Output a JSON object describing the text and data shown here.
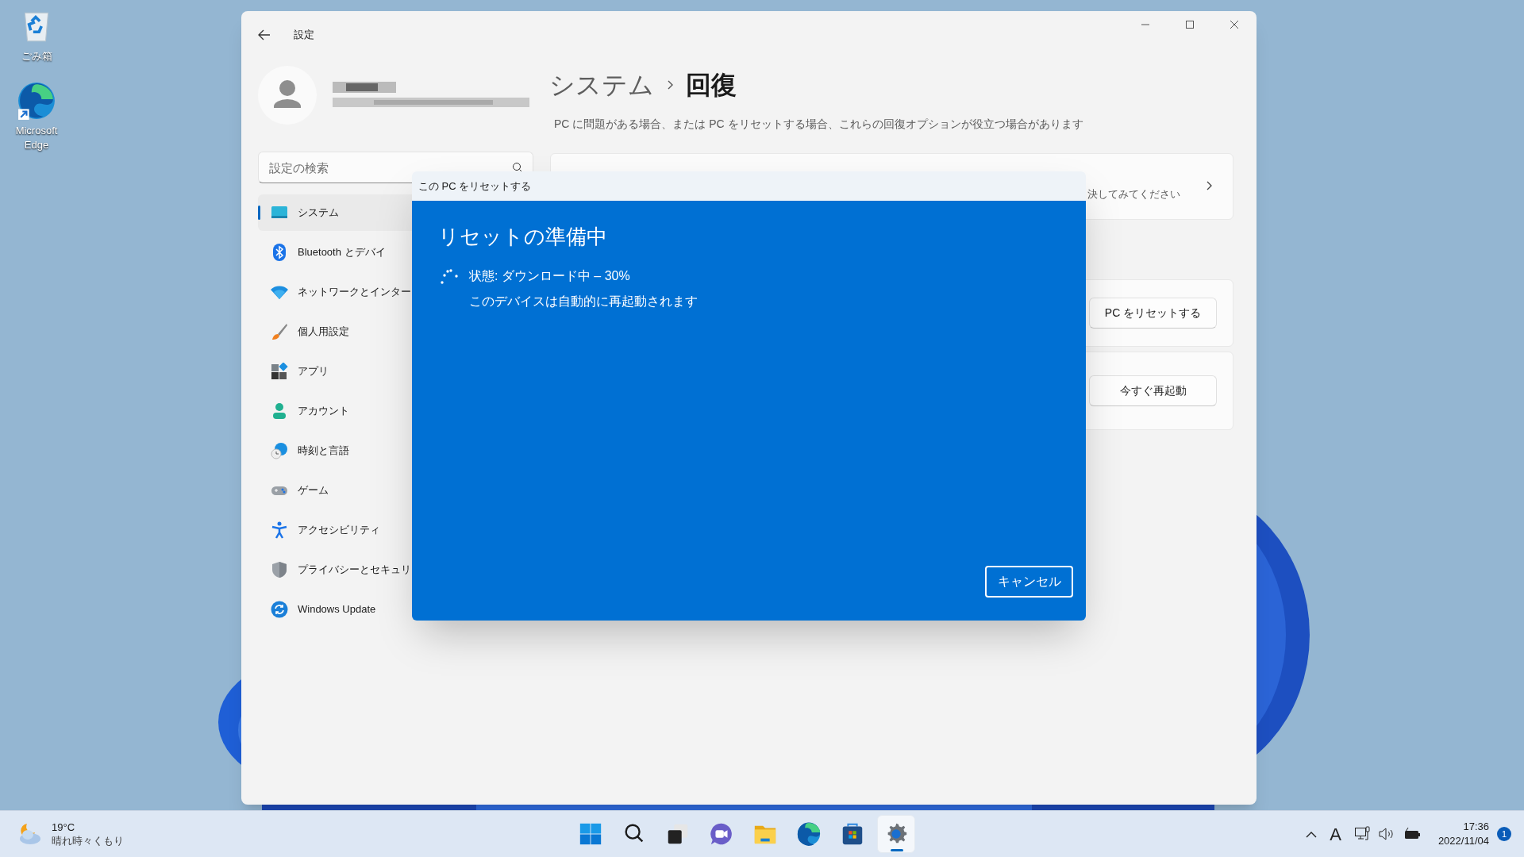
{
  "desktop": {
    "icons": [
      {
        "kind": "recycle-bin",
        "label": "ごみ箱"
      },
      {
        "kind": "edge-shortcut",
        "label": "Microsoft Edge"
      }
    ]
  },
  "settings_window": {
    "title": "設定",
    "search": {
      "placeholder": "設定の検索"
    },
    "sidebar": {
      "items": [
        {
          "kind": "system",
          "label": "システム",
          "selected": true
        },
        {
          "kind": "bluetooth",
          "label": "Bluetooth とデバイ",
          "selected": false
        },
        {
          "kind": "network",
          "label": "ネットワークとインター",
          "selected": false
        },
        {
          "kind": "personalization",
          "label": "個人用設定",
          "selected": false
        },
        {
          "kind": "apps",
          "label": "アプリ",
          "selected": false
        },
        {
          "kind": "accounts",
          "label": "アカウント",
          "selected": false
        },
        {
          "kind": "time",
          "label": "時刻と言語",
          "selected": false
        },
        {
          "kind": "gaming",
          "label": "ゲーム",
          "selected": false
        },
        {
          "kind": "accessibility",
          "label": "アクセシビリティ",
          "selected": false
        },
        {
          "kind": "privacy",
          "label": "プライバシーとセキュリ",
          "selected": false
        },
        {
          "kind": "update",
          "label": "Windows Update",
          "selected": false
        }
      ]
    },
    "breadcrumb": [
      "システム",
      "回復"
    ],
    "description": "PC に問題がある場合、または PC をリセットする場合、これらの回復オプションが役立つ場合があります",
    "cards": [
      {
        "kind": "link",
        "text": "決してみてください"
      },
      {
        "kind": "button",
        "button": "PC をリセットする"
      },
      {
        "kind": "button",
        "button": "今すぐ再起動"
      }
    ]
  },
  "dialog": {
    "title": "この PC をリセットする",
    "heading": "リセットの準備中",
    "status": "状態: ダウンロード中 – 30%",
    "note": "このデバイスは自動的に再起動されます",
    "cancel_button": "キャンセル"
  },
  "taskbar": {
    "weather": {
      "temperature": "19°C",
      "condition": "晴れ時々くもり"
    },
    "apps": [
      {
        "kind": "start",
        "active": false
      },
      {
        "kind": "search",
        "active": false
      },
      {
        "kind": "task-view",
        "active": false
      },
      {
        "kind": "chat",
        "active": false
      },
      {
        "kind": "explorer",
        "active": false
      },
      {
        "kind": "edge",
        "active": false
      },
      {
        "kind": "store",
        "active": false
      },
      {
        "kind": "settings",
        "active": true
      }
    ],
    "tray": {
      "ime": "A",
      "time": "17:36",
      "date": "2022/11/04",
      "notifications": "1"
    }
  }
}
